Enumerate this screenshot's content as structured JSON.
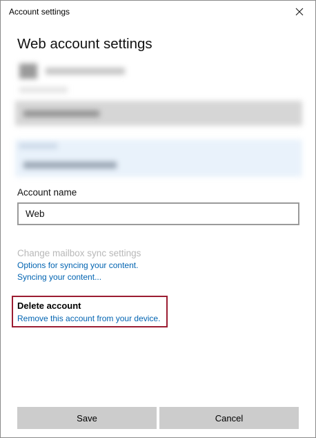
{
  "window": {
    "title": "Account settings"
  },
  "page": {
    "heading": "Web account settings"
  },
  "account_name": {
    "label": "Account name",
    "value": "Web"
  },
  "sync": {
    "title": "Change mailbox sync settings",
    "options_link": "Options for syncing your content.",
    "syncing_link": "Syncing your content..."
  },
  "delete": {
    "title": "Delete account",
    "link": "Remove this account from your device."
  },
  "buttons": {
    "save": "Save",
    "cancel": "Cancel"
  },
  "colors": {
    "link": "#0063b1",
    "highlight_border": "#9b1c31",
    "button_bg": "#cccccc",
    "disabled_text": "#b8b8b8"
  },
  "icons": {
    "close": "close-icon"
  }
}
